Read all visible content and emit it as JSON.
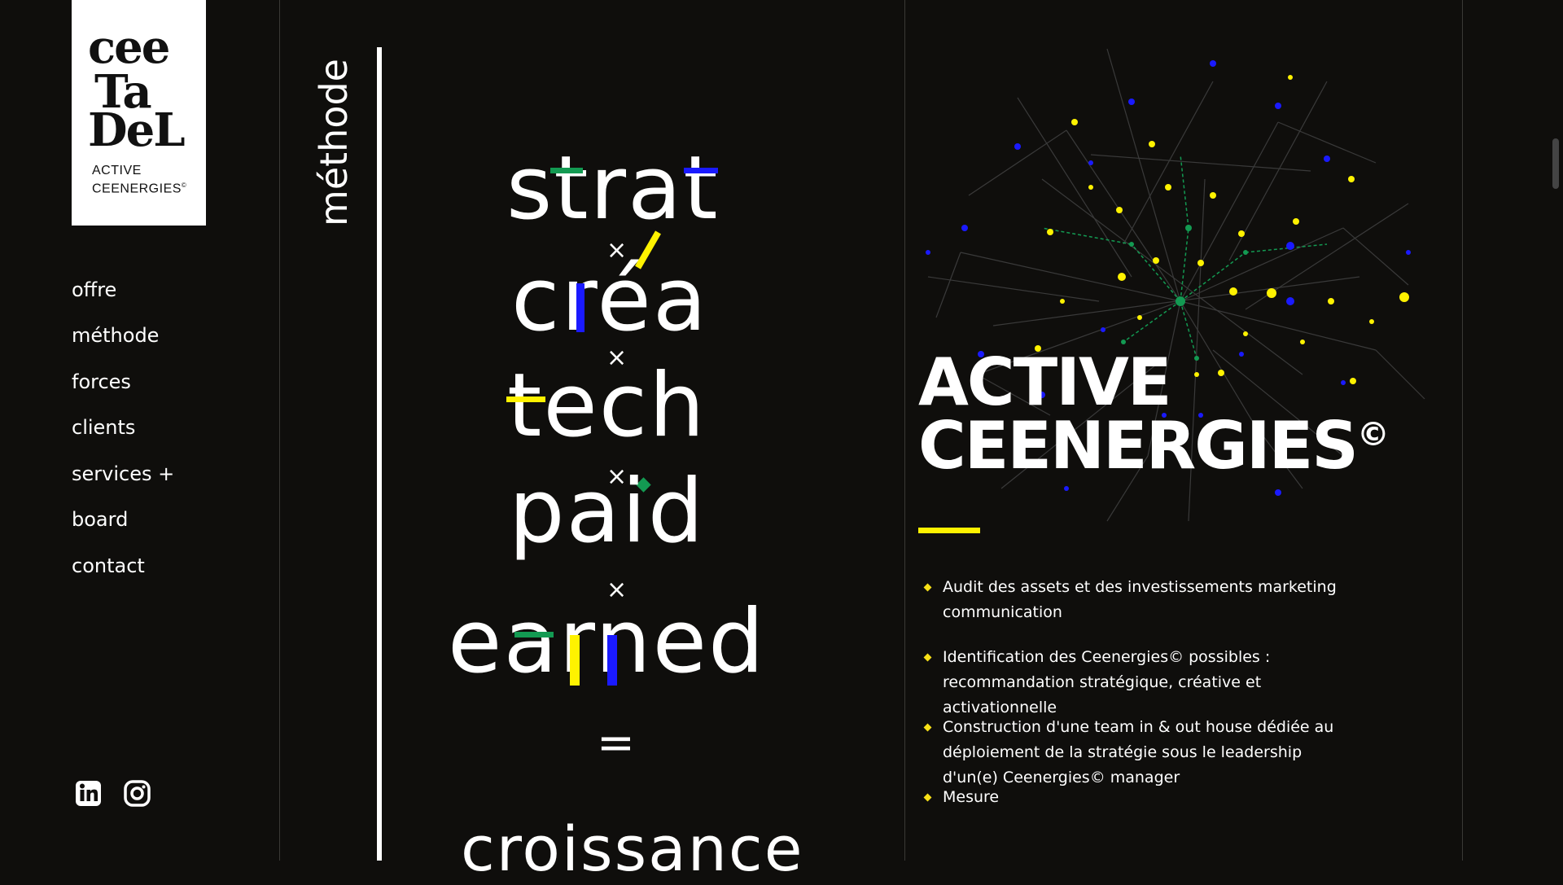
{
  "logo": {
    "line1": "cee",
    "line2": "Ta",
    "line3": "DeL",
    "sub1": "ACTIVE",
    "sub2": "CEENERGIES",
    "sub_mark": "©"
  },
  "nav": {
    "items": [
      "offre",
      "méthode",
      "forces",
      "clients",
      "services +",
      "board",
      "contact"
    ]
  },
  "social": {
    "linkedin_icon": "linkedin-icon",
    "instagram_icon": "instagram-icon"
  },
  "section": {
    "title": "méthode"
  },
  "formula": {
    "words": [
      "strat",
      "créa",
      "tech",
      "paid",
      "earned"
    ],
    "operator": "×",
    "equals": "=",
    "result": "croissance"
  },
  "headline": {
    "line1": "ACTIVE",
    "line2": "CEENERGIES",
    "mark": "©"
  },
  "bullets": [
    "Audit des assets et des investissements marketing communication",
    "Identification des Ceenergies© possibles : recommandation stratégique, créative et activationnelle",
    "Construction d'une team in & out house dédiée au déploiement de la stratégie sous le leadership d'un(e) Ceenergies© manager",
    "Mesure"
  ],
  "colors": {
    "background": "#0f0e0c",
    "accent_yellow": "#fff200",
    "accent_blue": "#1a1aff",
    "accent_green": "#139a52",
    "bullet_marker": "#f7e017"
  }
}
